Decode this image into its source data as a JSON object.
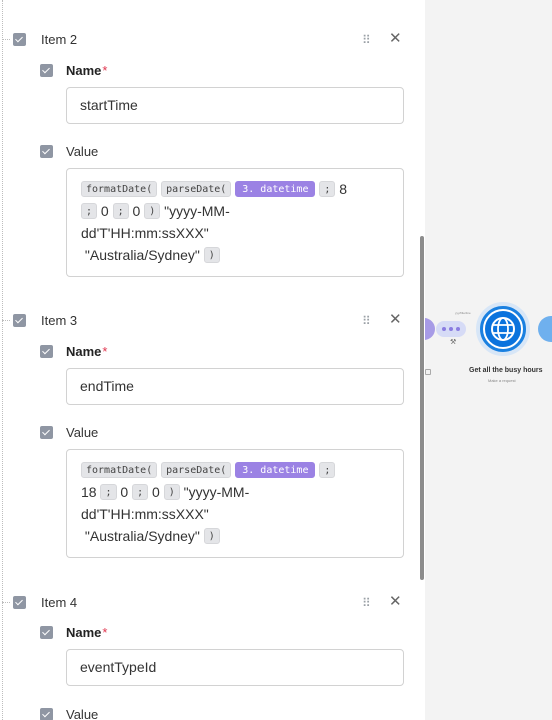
{
  "items": [
    {
      "title": "Item 2",
      "name_label": "Name",
      "name_value": "startTime",
      "value_label": "Value",
      "formula": {
        "fn1": "formatDate(",
        "fn2": "parseDate(",
        "var": "3. datetime",
        "sep": ";",
        "lines": [
          "8",
          "0",
          "0",
          "\"yyyy-MM-",
          "dd'T'HH:mm:ssXXX\"",
          "\"Australia/Sydney\""
        ],
        "close": ")"
      }
    },
    {
      "title": "Item 3",
      "name_label": "Name",
      "name_value": "endTime",
      "value_label": "Value",
      "formula": {
        "fn1": "formatDate(",
        "fn2": "parseDate(",
        "var": "3. datetime",
        "sep": ";",
        "lines": [
          "18",
          "0",
          "0",
          "\"yyyy-MM-",
          "dd'T'HH:mm:ssXXX\"",
          "\"Australia/Sydney\""
        ],
        "close": ")"
      }
    },
    {
      "title": "Item 4",
      "name_label": "Name",
      "name_value": "eventTypeId",
      "value_label": "Value"
    }
  ],
  "required_marker": "*",
  "icons": {
    "checkbox": "checkbox-checked-icon",
    "drag": "drag-handle-icon",
    "close": "close-icon",
    "globe": "globe-icon",
    "wrench": "wrench-icon"
  },
  "canvas": {
    "filter_caption": "yyy/filterline",
    "node_title": "Get all the busy hours",
    "node_subtitle": "Make a request"
  },
  "colors": {
    "variable_pill": "#9b82e4",
    "checkbox": "#8f96a3",
    "required": "#e0364f",
    "http_node": "#0a73dd"
  }
}
